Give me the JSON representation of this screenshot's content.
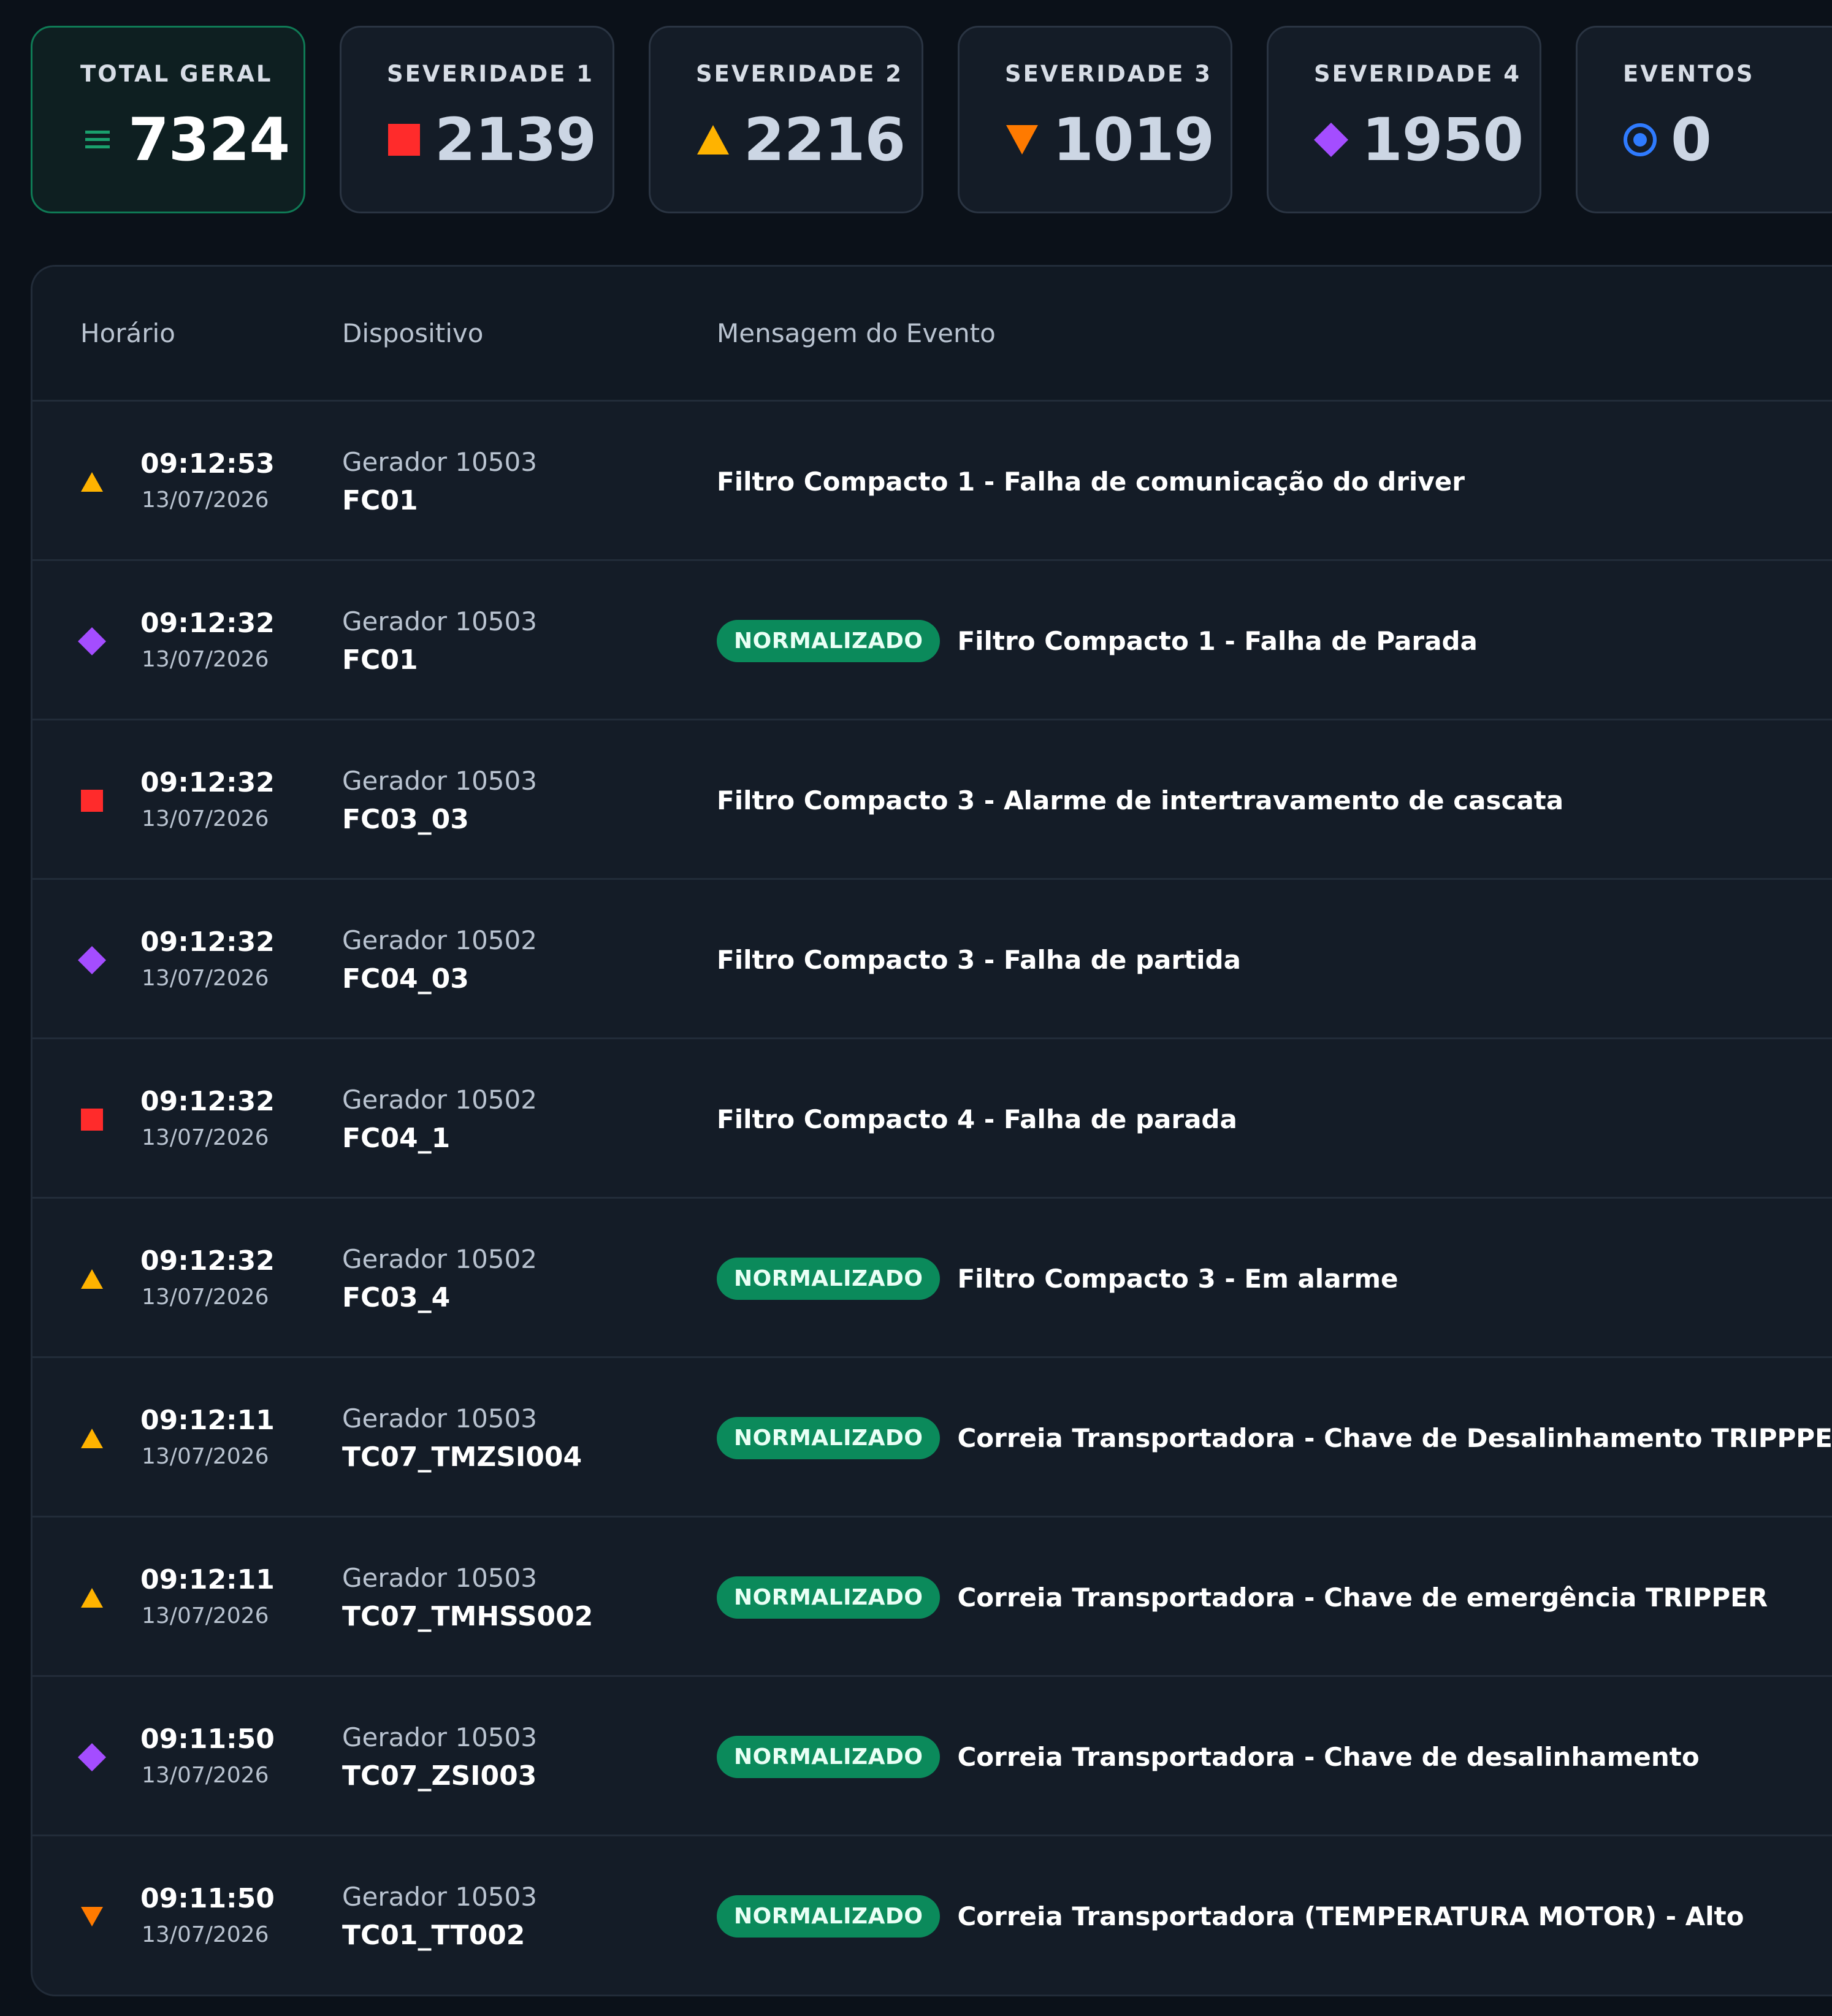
{
  "cards": [
    {
      "label": "TOTAL GERAL",
      "value": "7324",
      "icon": "menu-lines-icon",
      "color": "#1aa06d"
    },
    {
      "label": "SEVERIDADE 1",
      "value": "2139",
      "icon": "square-icon",
      "color": "#ff2b2b"
    },
    {
      "label": "SEVERIDADE 2",
      "value": "2216",
      "icon": "triangle-up-icon",
      "color": "#ffb300"
    },
    {
      "label": "SEVERIDADE 3",
      "value": "1019",
      "icon": "triangle-down-icon",
      "color": "#ff7a00"
    },
    {
      "label": "SEVERIDADE 4",
      "value": "1950",
      "icon": "diamond-icon",
      "color": "#a44dff"
    },
    {
      "label": "EVENTOS",
      "value": "0",
      "icon": "target-icon",
      "color": "#2f7bff"
    }
  ],
  "table": {
    "headers": {
      "time": "Horário",
      "device": "Dispositivo",
      "message": "Mensagem do Evento"
    },
    "badge_label": "NORMALIZADO",
    "rows": [
      {
        "severity": "triangle-up",
        "time": "09:12:53",
        "date": "13/07/2026",
        "device": "Gerador 10503",
        "tag": "FC01",
        "normalized": false,
        "message": "Filtro Compacto 1 - Falha de comunicação do driver"
      },
      {
        "severity": "diamond",
        "time": "09:12:32",
        "date": "13/07/2026",
        "device": "Gerador 10503",
        "tag": "FC01",
        "normalized": true,
        "message": "Filtro Compacto 1 - Falha de Parada"
      },
      {
        "severity": "square",
        "time": "09:12:32",
        "date": "13/07/2026",
        "device": "Gerador 10503",
        "tag": "FC03_03",
        "normalized": false,
        "message": "Filtro Compacto 3 - Alarme de intertravamento de cascata"
      },
      {
        "severity": "diamond",
        "time": "09:12:32",
        "date": "13/07/2026",
        "device": "Gerador 10502",
        "tag": "FC04_03",
        "normalized": false,
        "message": "Filtro Compacto 3 - Falha de partida"
      },
      {
        "severity": "square",
        "time": "09:12:32",
        "date": "13/07/2026",
        "device": "Gerador 10502",
        "tag": "FC04_1",
        "normalized": false,
        "message": "Filtro Compacto 4 - Falha de parada"
      },
      {
        "severity": "triangle-up",
        "time": "09:12:32",
        "date": "13/07/2026",
        "device": "Gerador 10502",
        "tag": "FC03_4",
        "normalized": true,
        "message": "Filtro Compacto 3 - Em alarme"
      },
      {
        "severity": "triangle-up",
        "time": "09:12:11",
        "date": "13/07/2026",
        "device": "Gerador 10503",
        "tag": "TC07_TMZSI004",
        "normalized": true,
        "message": "Correia Transportadora - Chave de Desalinhamento TRIPPPER"
      },
      {
        "severity": "triangle-up",
        "time": "09:12:11",
        "date": "13/07/2026",
        "device": "Gerador 10503",
        "tag": "TC07_TMHSS002",
        "normalized": true,
        "message": "Correia Transportadora - Chave de emergência TRIPPER"
      },
      {
        "severity": "diamond",
        "time": "09:11:50",
        "date": "13/07/2026",
        "device": "Gerador 10503",
        "tag": "TC07_ZSI003",
        "normalized": true,
        "message": "Correia Transportadora - Chave de desalinhamento"
      },
      {
        "severity": "triangle-down",
        "time": "09:11:50",
        "date": "13/07/2026",
        "device": "Gerador 10503",
        "tag": "TC01_TT002",
        "normalized": true,
        "message": "Correia Transportadora (TEMPERATURA MOTOR) - Alto"
      }
    ]
  },
  "severity_colors": {
    "square": "#ff2b2b",
    "triangle-up": "#ffb300",
    "triangle-down": "#ff7a00",
    "diamond": "#a44dff"
  }
}
